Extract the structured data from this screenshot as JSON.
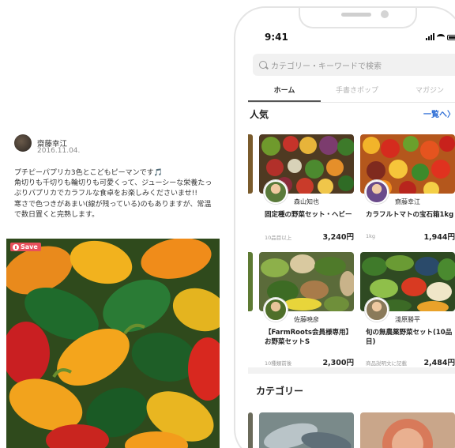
{
  "post": {
    "author": "齋藤幸江",
    "date": "2016.11.04.",
    "body": "プチピーパプリカ3色とこどもピーマンです🎵\n角切りも千切りも輪切りも可愛くって、ジューシーな栄養たっぷりパプリカでカラフルな食卓をお楽しみくださいませ!!\n寒さで色つきがあまい(線が残っている)のもありますが、常温で数日置くと完熟します。",
    "save_label": "Save"
  },
  "phone": {
    "time": "9:41",
    "search_placeholder": "カテゴリー・キーワードで検索",
    "tabs": [
      {
        "label": "ホーム",
        "active": true
      },
      {
        "label": "手書きポップ",
        "active": false
      },
      {
        "label": "マガジン",
        "active": false
      }
    ],
    "popular": {
      "title": "人気",
      "see_all": "一覧へ〉"
    },
    "products": [
      {
        "farmer": "森山知也",
        "title": "固定種の野菜セット・ヘビー",
        "sub": "10品目以上",
        "price": "3,240円"
      },
      {
        "farmer": "齋藤幸江",
        "title": "カラフルトマトの宝石箱1kg",
        "sub": "1kg",
        "price": "1,944円"
      },
      {
        "farmer": "佐藤暁彦",
        "title": "【FarmRoots会員様専用】お野菜セットS",
        "sub": "10種類前後",
        "price": "2,300円"
      },
      {
        "farmer": "淺原勝平",
        "title": "旬の無農薬野菜セット(10品目)",
        "sub": "商品説明文に記載",
        "price": "2,484円"
      }
    ],
    "category_title": "カテゴリー"
  }
}
